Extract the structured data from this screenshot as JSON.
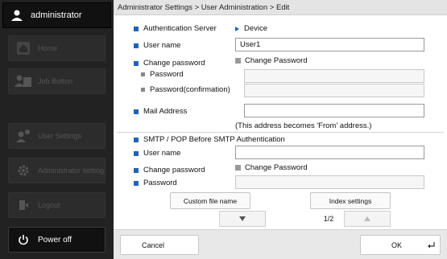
{
  "sidebar": {
    "user": "administrator",
    "items": [
      {
        "label": "Home",
        "icon": "home-icon"
      },
      {
        "label": "Job Button",
        "icon": "job-button-icon"
      },
      {
        "label": "User Settings",
        "icon": "user-settings-icon"
      },
      {
        "label": "Administrator setting",
        "icon": "admin-setting-icon"
      },
      {
        "label": "Logout",
        "icon": "logout-icon"
      }
    ],
    "power": "Power off"
  },
  "breadcrumb": "Administrator Settings > User Administration > Edit",
  "form": {
    "auth_server_label": "Authentication Server",
    "auth_server_value": "Device",
    "username_label": "User name",
    "username_value": "User1",
    "change_password_label": "Change password",
    "change_password_checkbox": "Change Password",
    "password_label": "Password",
    "password_confirm_label": "Password(confirmation)",
    "mail_label": "Mail Address",
    "mail_value": "",
    "mail_note": "(This address becomes 'From' address.)",
    "smtp_section": "SMTP / POP Before SMTP Authentication",
    "smtp_username_label": "User name",
    "smtp_username_value": "",
    "smtp_change_password_label": "Change password",
    "smtp_change_password_checkbox": "Change Password",
    "smtp_password_label": "Password"
  },
  "buttons": {
    "custom_file_name": "Custom file name",
    "index_settings": "Index settings"
  },
  "pager": {
    "text": "1/2"
  },
  "footer": {
    "cancel": "Cancel",
    "ok": "OK"
  },
  "colors": {
    "accent": "#1f63b6",
    "sidebar_bg": "#222222"
  }
}
